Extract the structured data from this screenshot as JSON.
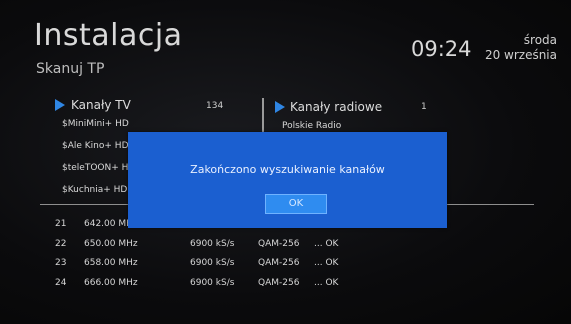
{
  "header": {
    "title": "Instalacja",
    "subtitle": "Skanuj TP",
    "time": "09:24",
    "day": "środa",
    "date": "20 września"
  },
  "tv_list": {
    "label": "Kanały TV",
    "count": "134",
    "items": [
      "$MiniMini+ HD",
      "$Ale Kino+ HD",
      "$teleTOON+ H",
      "$Kuchnia+ HD"
    ]
  },
  "radio_list": {
    "label": "Kanały radiowe",
    "count": "1",
    "items": [
      "Polskie Radio"
    ]
  },
  "scan_rows": [
    {
      "num": "21",
      "freq": "642.00 MH",
      "rate": "",
      "mod": "",
      "status": ""
    },
    {
      "num": "22",
      "freq": "650.00 MHz",
      "rate": "6900 kS/s",
      "mod": "QAM-256",
      "status": "... OK"
    },
    {
      "num": "23",
      "freq": "658.00 MHz",
      "rate": "6900 kS/s",
      "mod": "QAM-256",
      "status": "... OK"
    },
    {
      "num": "24",
      "freq": "666.00 MHz",
      "rate": "6900 kS/s",
      "mod": "QAM-256",
      "status": "... OK"
    }
  ],
  "dialog": {
    "message": "Zakończono wyszukiwanie kanałów",
    "ok_label": "OK"
  },
  "colors": {
    "dialog_bg": "#1b5fd0",
    "button_bg": "#2f8cf0",
    "triangle": "#2f86e4"
  }
}
